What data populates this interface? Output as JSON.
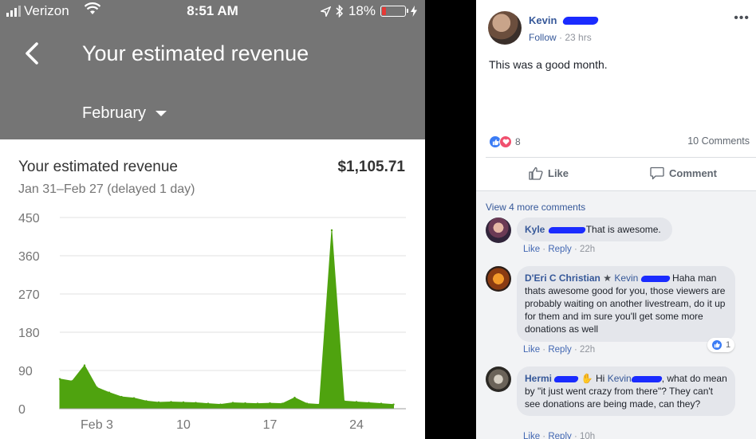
{
  "status_bar": {
    "carrier": "Verizon",
    "time": "8:51 AM",
    "battery_percent": "18%",
    "battery_level": 0.18
  },
  "app_bar": {
    "title": "Your estimated revenue",
    "month": "February"
  },
  "card": {
    "title": "Your estimated revenue",
    "value": "$1,105.71",
    "date_range": "Jan 31–Feb 27 (delayed 1 day)"
  },
  "chart_data": {
    "type": "area",
    "title": "",
    "xlabel": "",
    "ylabel": "",
    "y_ticks": [
      0,
      90,
      180,
      270,
      360,
      450
    ],
    "ylim": [
      0,
      450
    ],
    "x_tick_labels": [
      {
        "day": 3,
        "label": "Feb 3"
      },
      {
        "day": 10,
        "label": "10"
      },
      {
        "day": 17,
        "label": "17"
      },
      {
        "day": 24,
        "label": "24"
      }
    ],
    "xlim": [
      0,
      28
    ],
    "grid": true,
    "color": "#4fa30f",
    "series": [
      {
        "x": [
          0,
          1,
          2,
          3,
          4,
          5,
          6,
          7,
          8,
          9,
          10,
          11,
          12,
          13,
          14,
          15,
          16,
          17,
          18,
          19,
          20,
          21,
          22,
          23,
          24,
          25,
          26,
          27
        ],
        "values": [
          70,
          65,
          102,
          50,
          38,
          28,
          25,
          18,
          15,
          16,
          15,
          14,
          12,
          10,
          14,
          13,
          12,
          13,
          12,
          26,
          12,
          10,
          420,
          18,
          16,
          14,
          12,
          10
        ]
      }
    ]
  },
  "post": {
    "author": "Kevin",
    "follow": "Follow",
    "time": "23 hrs",
    "text": "This was a good month.",
    "reaction_count": "8",
    "comments_count": "10 Comments",
    "like_label": "Like",
    "comment_label": "Comment",
    "view_more": "View 4 more comments"
  },
  "comments": [
    {
      "author": "Kyle",
      "text": "That is awesome.",
      "like": "Like",
      "reply": "Reply",
      "time": "22h"
    },
    {
      "author": "D'Eri C Christian",
      "tag": "Kevin",
      "text": "Haha man thats awesome good for you, those viewers are probably waiting on another livestream, do it up for them and im sure you'll get some more donations as well",
      "like": "Like",
      "reply": "Reply",
      "time": "22h",
      "reactions": "1"
    },
    {
      "author": "Hermi",
      "greeting": "Hi",
      "tag": "Kevin",
      "text": ", what do mean by \"it just went crazy from there\"? They can't see donations are being made, can they?",
      "like": "Like",
      "reply": "Reply",
      "time": "10h"
    }
  ]
}
